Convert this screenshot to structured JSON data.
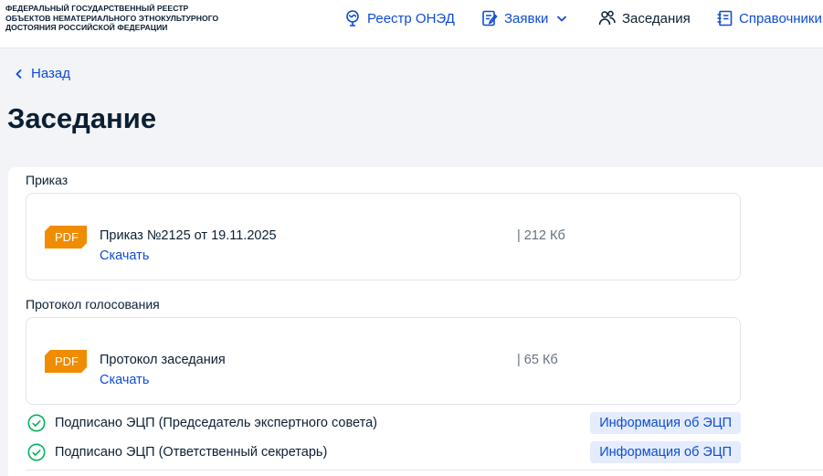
{
  "header": {
    "logo_lines": [
      "ФЕДЕРАЛЬНЫЙ ГОСУДАРСТВЕННЫЙ РЕЕСТР",
      "ОБЪЕКТОВ НЕМАТЕРИАЛЬНОГО ЭТНОКУЛЬТУРНОГО",
      "ДОСТОЯНИЯ РОССИЙСКОЙ ФЕДЕРАЦИИ"
    ],
    "nav": [
      {
        "label": "Реестр ОНЭД",
        "icon": "globe-icon"
      },
      {
        "label": "Заявки",
        "icon": "application-icon"
      },
      {
        "label": "Заседания",
        "icon": "people-icon"
      },
      {
        "label": "Справочники",
        "icon": "reference-icon"
      }
    ]
  },
  "back_label": "Назад",
  "page_title": "Заседание",
  "sections": {
    "order": {
      "label": "Приказ",
      "file_type": "PDF",
      "name": "Приказ №2125 от 19.11.2025",
      "download": "Скачать",
      "size": "| 212 Кб"
    },
    "protocol": {
      "label": "Протокол голосования",
      "file_type": "PDF",
      "name": "Протокол заседания",
      "download": "Скачать",
      "size": "| 65 Кб"
    }
  },
  "signatures": [
    {
      "text": "Подписано ЭЦП (Председатель экспертного совета)",
      "button": "Информация об ЭЦП"
    },
    {
      "text": "Подписано ЭЦП (Ответственный секретарь)",
      "button": "Информация об ЭЦП"
    }
  ],
  "colors": {
    "accent": "#0d4cd3",
    "pdf_badge": "#f08c00",
    "success": "#00b25a",
    "button_bg": "#e4ecfd"
  }
}
